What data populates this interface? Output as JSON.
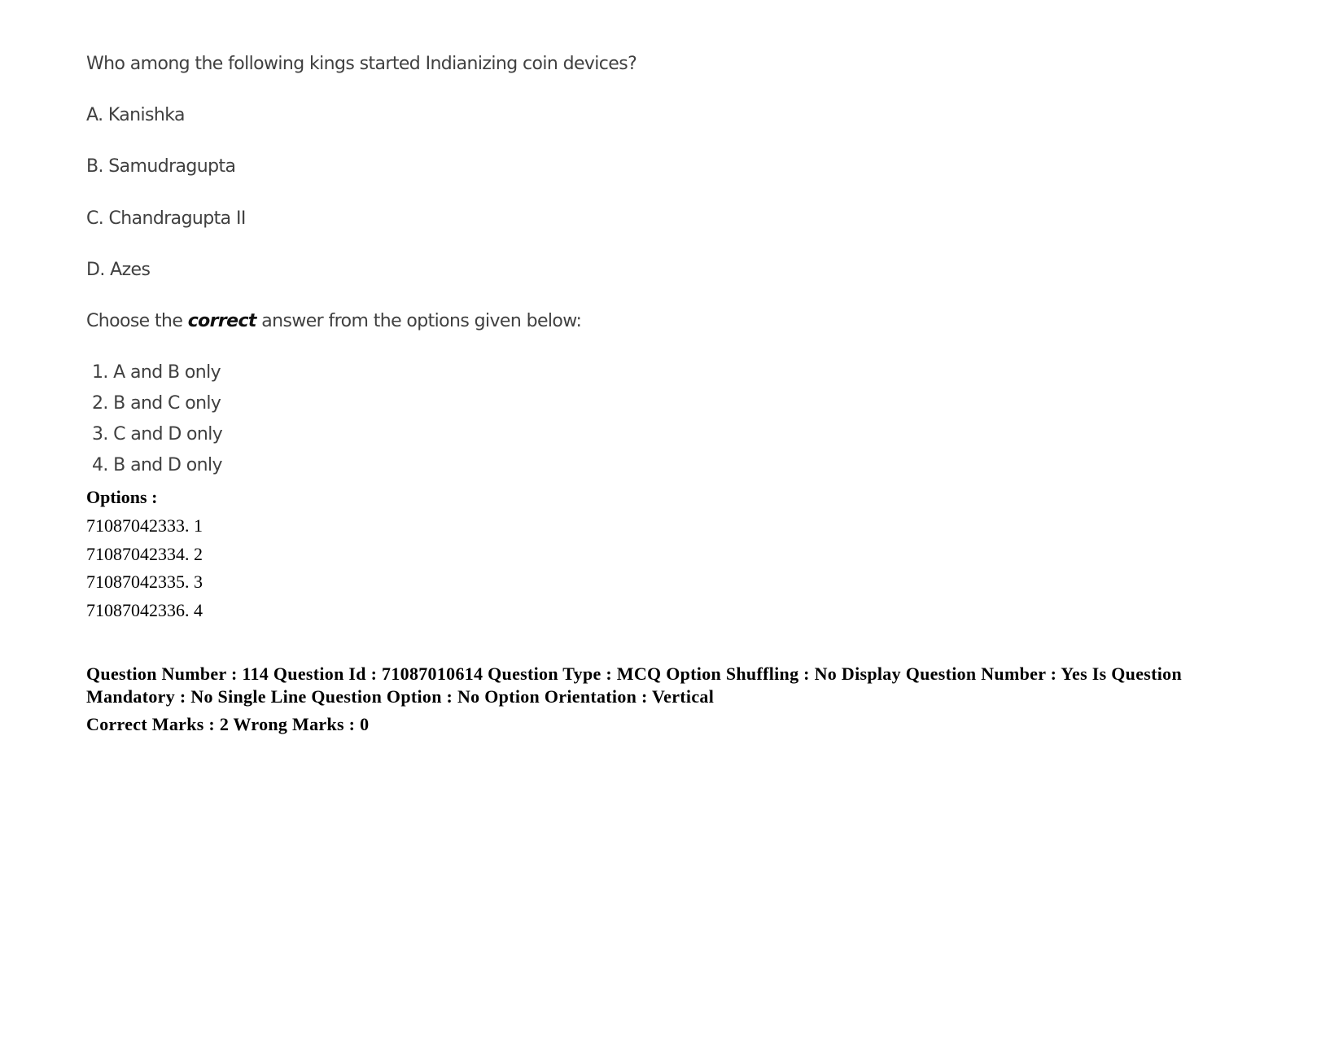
{
  "question": {
    "text": "Who among the following kings started Indianizing coin devices?",
    "statements": [
      "A. Kanishka",
      "B. Samudragupta",
      "C. Chandragupta II",
      "D. Azes"
    ],
    "instruction": {
      "before": "Choose the ",
      "emphasis": "correct",
      "after": " answer from the options given below:"
    },
    "choices": [
      "1. A and B only",
      "2. B and C only",
      "3. C and D only",
      "4. B and D only"
    ]
  },
  "options": {
    "label": "Options :",
    "items": [
      "71087042333. 1",
      "71087042334. 2",
      "71087042335. 3",
      "71087042336. 4"
    ]
  },
  "meta": {
    "text": "Question Number : 114 Question Id : 71087010614 Question Type : MCQ Option Shuffling : No Display Question Number : Yes Is Question Mandatory : No Single Line Question Option : No Option Orientation : Vertical",
    "marks": "Correct Marks : 2 Wrong Marks : 0"
  }
}
